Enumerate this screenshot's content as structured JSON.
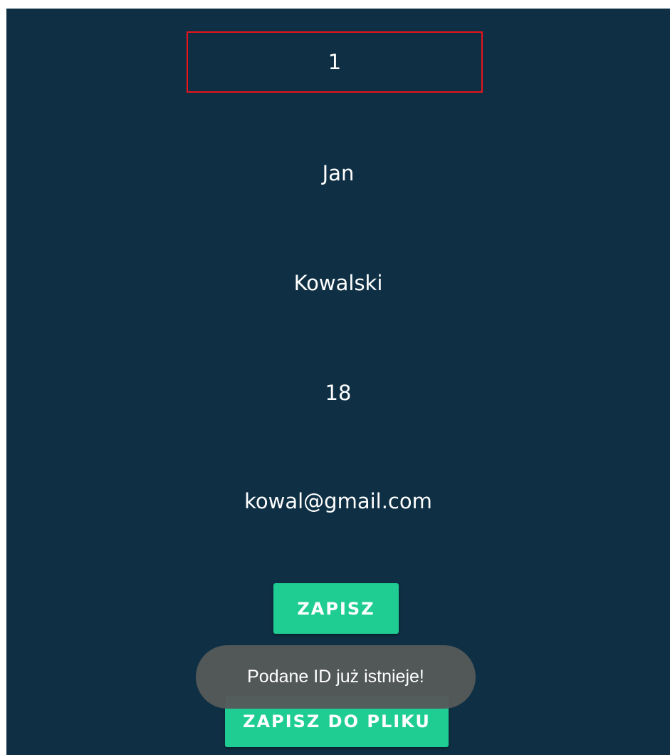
{
  "form": {
    "id_value": "1",
    "first_name": "Jan",
    "last_name": "Kowalski",
    "age": "18",
    "email": "kowal@gmail.com"
  },
  "buttons": {
    "save_label": "ZAPISZ",
    "save_to_file_label": "ZAPISZ DO PLIKU"
  },
  "toast": {
    "message": "Podane ID już istnieje!"
  },
  "colors": {
    "background": "#0f3044",
    "accent": "#1fcd93",
    "highlight_border": "#e8141c",
    "toast_background": "#55585a"
  }
}
